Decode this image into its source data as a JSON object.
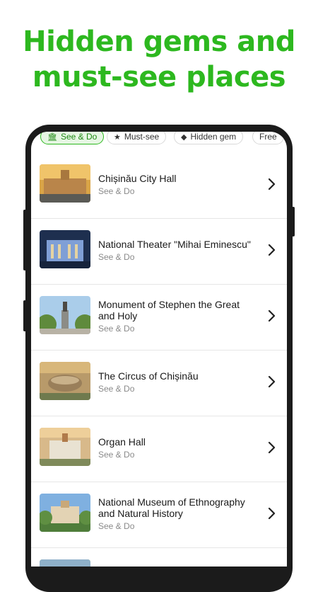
{
  "headline": {
    "line1": "Hidden gems and",
    "line2": "must-see places"
  },
  "chips": [
    {
      "label": "See & Do",
      "icon": "landmark-icon",
      "active": true
    },
    {
      "label": "Must-see",
      "icon": "star-icon",
      "active": false
    },
    {
      "label": "Hidden gem",
      "icon": "diamond-icon",
      "active": false
    },
    {
      "label": "Free",
      "icon": "",
      "active": false
    }
  ],
  "places": [
    {
      "title": "Chișinău City Hall",
      "subtitle": "See & Do"
    },
    {
      "title": "National Theater \"Mihai Eminescu\"",
      "subtitle": "See & Do"
    },
    {
      "title": "Monument of Stephen the Great and Holy",
      "subtitle": "See & Do"
    },
    {
      "title": "The Circus of Chișinău",
      "subtitle": "See & Do"
    },
    {
      "title": "Organ Hall",
      "subtitle": "See & Do"
    },
    {
      "title": "National Museum of Ethnography and Natural History",
      "subtitle": "See & Do"
    }
  ],
  "colors": {
    "accent": "#2db81f",
    "phone": "#1b1b1b"
  }
}
